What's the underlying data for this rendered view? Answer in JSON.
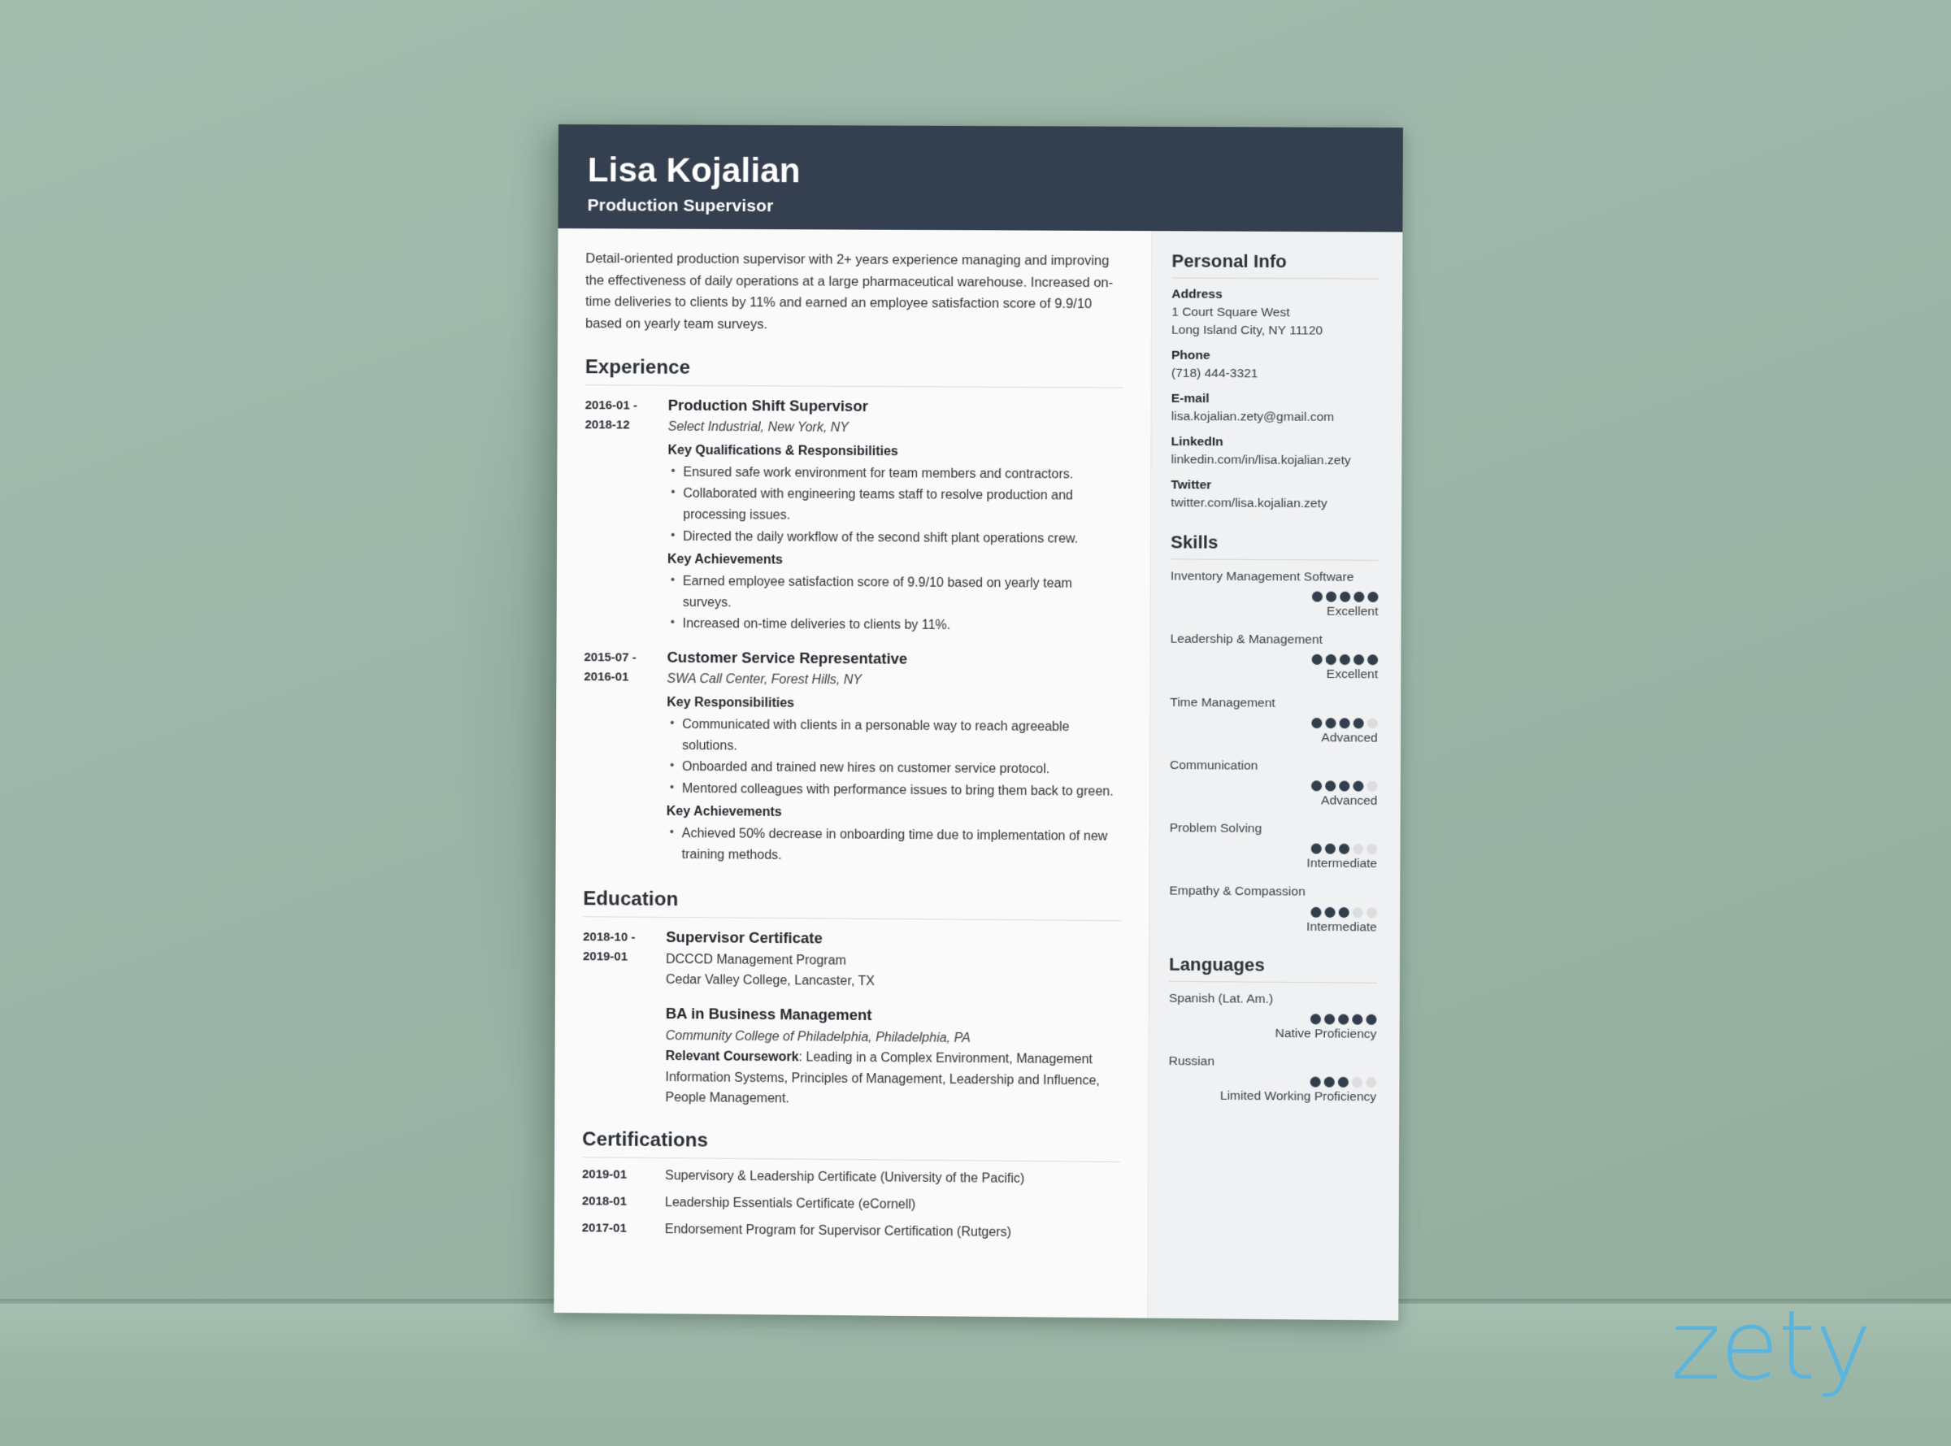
{
  "background": {
    "wall_color": "#9db6a9",
    "floor_color": "#9cb7a8"
  },
  "brand": {
    "logo_text": "zety",
    "logo_color": "#5bb4dd"
  },
  "resume": {
    "header": {
      "name": "Lisa Kojalian",
      "job_title": "Production Supervisor",
      "bg_color": "#343f4f"
    },
    "summary": "Detail-oriented production supervisor with 2+ years experience managing and improving the effectiveness of daily operations at a large pharmaceutical warehouse. Increased on-time deliveries to clients by 11% and earned an employee satisfaction score of 9.9/10 based on yearly team surveys.",
    "sections": {
      "experience_title": "Experience",
      "education_title": "Education",
      "certifications_title": "Certifications"
    },
    "experience": [
      {
        "date_from": "2016-01 -",
        "date_to": "2018-12",
        "title": "Production Shift Supervisor",
        "organization": "Select Industrial, New York, NY",
        "groups": [
          {
            "heading": "Key Qualifications & Responsibilities",
            "items": [
              "Ensured safe work environment for team members and contractors.",
              "Collaborated with engineering teams staff to resolve production and processing issues.",
              "Directed the daily workflow of the second shift plant operations crew."
            ]
          },
          {
            "heading": "Key Achievements",
            "items": [
              "Earned employee satisfaction score of 9.9/10 based on yearly team surveys.",
              "Increased on-time deliveries to clients by 11%."
            ]
          }
        ]
      },
      {
        "date_from": "2015-07 -",
        "date_to": "2016-01",
        "title": "Customer Service Representative",
        "organization": "SWA Call Center, Forest Hills, NY",
        "groups": [
          {
            "heading": "Key Responsibilities",
            "items": [
              "Communicated with clients in a personable way to reach agreeable solutions.",
              "Onboarded and trained new hires on customer service protocol.",
              "Mentored colleagues with performance issues to bring them back to green."
            ]
          },
          {
            "heading": "Key Achievements",
            "items": [
              "Achieved 50% decrease in onboarding time due to implementation of new training methods."
            ]
          }
        ]
      }
    ],
    "education": {
      "date_from": "2018-10 -",
      "date_to": "2019-01",
      "entry1_title": "Supervisor Certificate",
      "entry1_line1": "DCCCD Management Program",
      "entry1_line2": "Cedar Valley College, Lancaster, TX",
      "entry2_title": "BA in Business Management",
      "entry2_org": "Community College of Philadelphia, Philadelphia, PA",
      "entry2_coursework_label": "Relevant Coursework",
      "entry2_coursework_text": ": Leading in a Complex Environment, Management Information Systems, Principles of Management, Leadership and Influence, People Management."
    },
    "certifications": [
      {
        "date": "2019-01",
        "text": "Supervisory & Leadership Certificate (University of the Pacific)"
      },
      {
        "date": "2018-01",
        "text": "Leadership Essentials Certificate (eCornell)"
      },
      {
        "date": "2017-01",
        "text": "Endorsement Program for Supervisor Certification (Rutgers)"
      }
    ],
    "sidebar": {
      "personal_info_title": "Personal Info",
      "fields": [
        {
          "label": "Address",
          "value": "1 Court Square West",
          "value2": "Long Island City, NY 11120"
        },
        {
          "label": "Phone",
          "value": "(718) 444-3321"
        },
        {
          "label": "E-mail",
          "value": "lisa.kojalian.zety@gmail.com"
        },
        {
          "label": "LinkedIn",
          "value": "linkedin.com/in/lisa.kojalian.zety"
        },
        {
          "label": "Twitter",
          "value": "twitter.com/lisa.kojalian.zety"
        }
      ],
      "skills_title": "Skills",
      "skills": [
        {
          "name": "Inventory Management Software",
          "filled": 5,
          "total": 5,
          "level": "Excellent"
        },
        {
          "name": "Leadership & Management",
          "filled": 5,
          "total": 5,
          "level": "Excellent"
        },
        {
          "name": "Time Management",
          "filled": 4,
          "total": 5,
          "level": "Advanced"
        },
        {
          "name": "Communication",
          "filled": 4,
          "total": 5,
          "level": "Advanced"
        },
        {
          "name": "Problem Solving",
          "filled": 3,
          "total": 5,
          "level": "Intermediate"
        },
        {
          "name": "Empathy & Compassion",
          "filled": 3,
          "total": 5,
          "level": "Intermediate"
        }
      ],
      "languages_title": "Languages",
      "languages": [
        {
          "name": "Spanish (Lat. Am.)",
          "filled": 5,
          "total": 5,
          "level": "Native Proficiency"
        },
        {
          "name": "Russian",
          "filled": 3,
          "total": 5,
          "level": "Limited Working Proficiency"
        }
      ],
      "dot_on_color": "#333e4d",
      "dot_off_color": "#dcdddf"
    }
  }
}
